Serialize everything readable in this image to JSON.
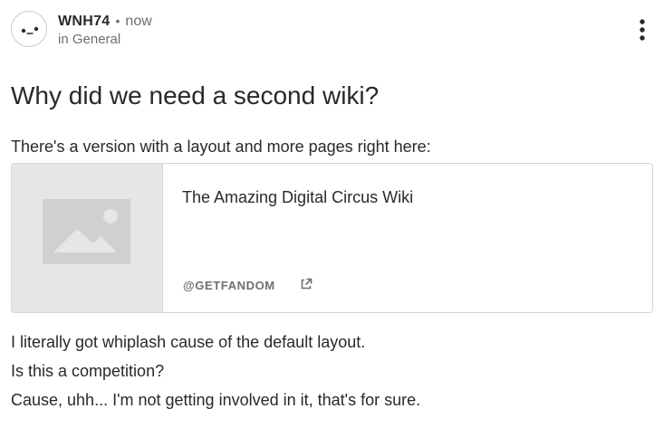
{
  "author": {
    "name": "WNH74",
    "separator": "•",
    "timestamp": "now",
    "category_text": "in General"
  },
  "post": {
    "title": "Why did we need a second wiki?",
    "intro": "There's a version with a layout and more pages right here:",
    "paragraphs": [
      "I literally got whiplash cause of the default layout.",
      "Is this a competition?",
      "Cause, uhh... I'm not getting involved in it, that's for sure."
    ]
  },
  "link_card": {
    "title": "The Amazing Digital Circus Wiki",
    "source": "@GETFANDOM",
    "thumbnail_icon": "image-placeholder-icon",
    "source_icon": "external-link-icon"
  },
  "menu_icon": "kebab-menu-icon",
  "avatar_icon": "face-avatar-icon",
  "colors": {
    "text": "#29292b",
    "muted": "#6f6f73",
    "border": "#d6d6d8",
    "thumb_bg": "#e6e6e6",
    "thumb_fg": "#d0d0d0"
  }
}
